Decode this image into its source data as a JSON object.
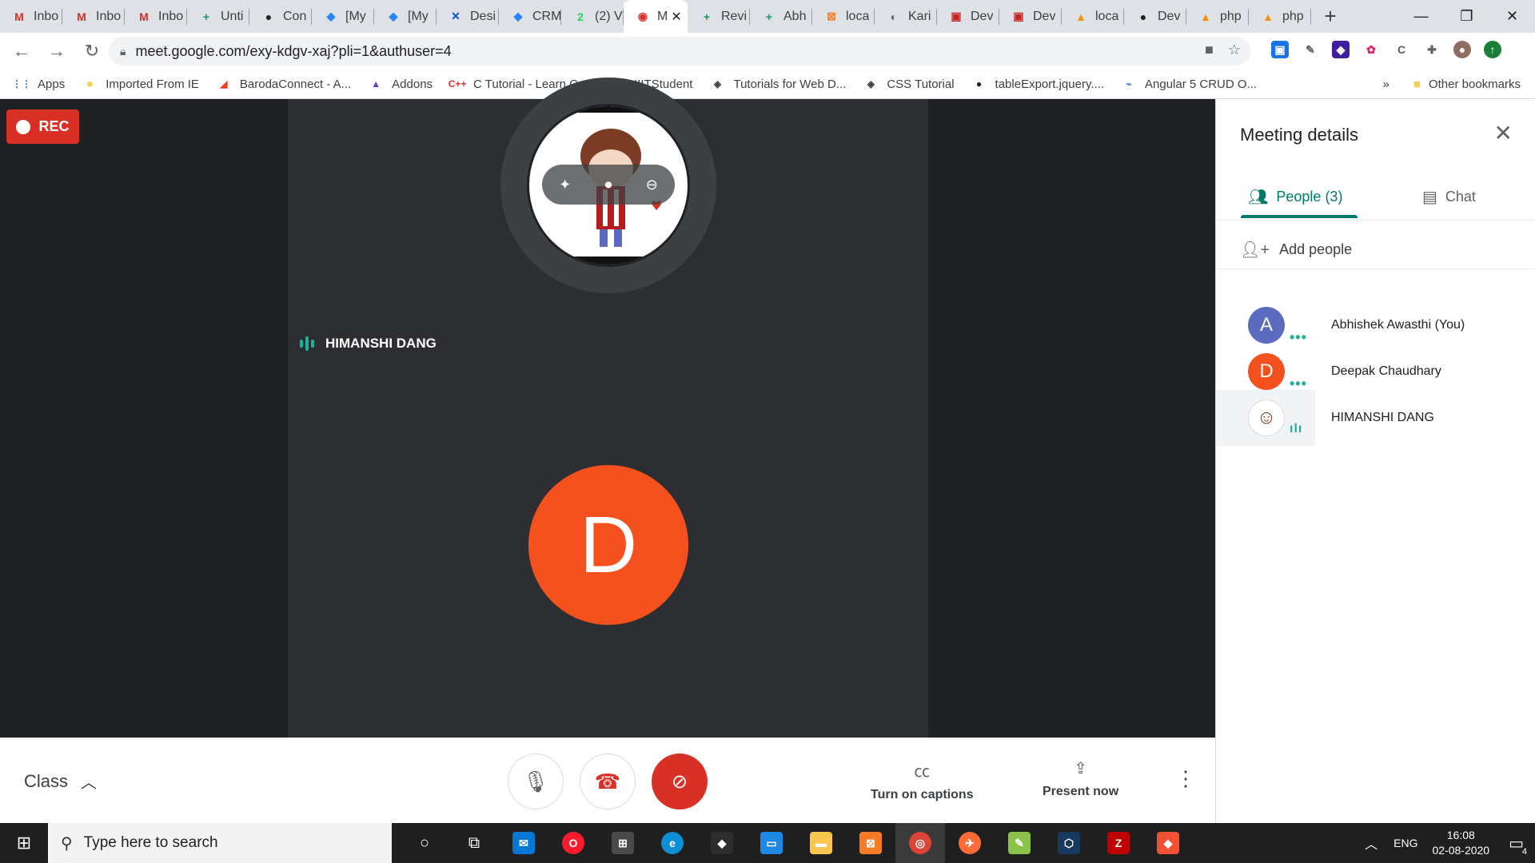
{
  "browser": {
    "tabs": [
      {
        "title": "Inbo",
        "icon": "gmail-icon",
        "color": "#d93025",
        "glyph": "M"
      },
      {
        "title": "Inbo",
        "icon": "gmail-icon",
        "color": "#d93025",
        "glyph": "M"
      },
      {
        "title": "Inbo",
        "icon": "gmail-icon",
        "color": "#d93025",
        "glyph": "M"
      },
      {
        "title": "Unti",
        "icon": "sheets-icon",
        "color": "#0f9d58",
        "glyph": "+"
      },
      {
        "title": "Con",
        "icon": "github-icon",
        "color": "#202124",
        "glyph": "●"
      },
      {
        "title": "[My",
        "icon": "jira-icon",
        "color": "#2684ff",
        "glyph": "◆"
      },
      {
        "title": "[My",
        "icon": "jira-icon",
        "color": "#2684ff",
        "glyph": "◆"
      },
      {
        "title": "Desi",
        "icon": "confluence-icon",
        "color": "#0052cc",
        "glyph": "✕"
      },
      {
        "title": "CRM",
        "icon": "jira-icon",
        "color": "#2684ff",
        "glyph": "◆"
      },
      {
        "title": "(2) V",
        "icon": "whatsapp-icon",
        "color": "#25d366",
        "glyph": "2"
      },
      {
        "title": "M",
        "icon": "recording-icon",
        "color": "#d93025",
        "glyph": "◉",
        "active": true
      },
      {
        "title": "Revi",
        "icon": "sheets-icon",
        "color": "#0f9d58",
        "glyph": "+"
      },
      {
        "title": "Abh",
        "icon": "sheets-icon",
        "color": "#0f9d58",
        "glyph": "+"
      },
      {
        "title": "loca",
        "icon": "xampp-icon",
        "color": "#fb7a24",
        "glyph": "⊠"
      },
      {
        "title": "Kari",
        "icon": "globe-icon",
        "color": "#5f6368",
        "glyph": "◐"
      },
      {
        "title": "Dev",
        "icon": "devtool-icon",
        "color": "#c5221f",
        "glyph": "▣"
      },
      {
        "title": "Dev",
        "icon": "devtool-icon",
        "color": "#c5221f",
        "glyph": "▣"
      },
      {
        "title": "loca",
        "icon": "phpmyadmin-icon",
        "color": "#f29111",
        "glyph": "▲"
      },
      {
        "title": "Dev",
        "icon": "github-icon",
        "color": "#202124",
        "glyph": "●"
      },
      {
        "title": "php",
        "icon": "phpmyadmin-icon",
        "color": "#f29111",
        "glyph": "▲"
      },
      {
        "title": "php",
        "icon": "phpmyadmin-icon",
        "color": "#f29111",
        "glyph": "▲"
      }
    ],
    "url": "meet.google.com/exy-kdgv-xaj?pli=1&authuser=4",
    "bookmarks": [
      {
        "label": "Apps",
        "icon": "apps-grid-icon",
        "color": "#1a73e8",
        "glyph": "⋮⋮"
      },
      {
        "label": "Imported From IE",
        "icon": "folder-icon",
        "color": "#f9ce4b",
        "glyph": "■"
      },
      {
        "label": "BarodaConnect - A...",
        "icon": "baroda-icon",
        "color": "#e8401c",
        "glyph": "◢"
      },
      {
        "label": "Addons",
        "icon": "addons-icon",
        "color": "#673ab7",
        "glyph": "▲"
      },
      {
        "label": "C Tutorial - Learn C...",
        "icon": "cpp-icon",
        "color": "#d93025",
        "glyph": "C++"
      },
      {
        "label": "NIITStudent",
        "icon": "globe-icon",
        "color": "#3c4043",
        "glyph": "◐"
      },
      {
        "label": "Tutorials for Web D...",
        "icon": "diamond-icon",
        "color": "#3c4043",
        "glyph": "◈"
      },
      {
        "label": "CSS Tutorial",
        "icon": "diamond-icon",
        "color": "#3c4043",
        "glyph": "◈"
      },
      {
        "label": "tableExport.jquery....",
        "icon": "github-icon",
        "color": "#202124",
        "glyph": "●"
      },
      {
        "label": "Angular 5 CRUD O...",
        "icon": "angular-icon",
        "color": "#4285f4",
        "glyph": "⌁"
      }
    ],
    "bookmarks_overflow": "»",
    "other_bookmarks": "Other bookmarks"
  },
  "meet": {
    "rec_label": "REC",
    "speaker_name": "HIMANSHI DANG",
    "self_initial": "D",
    "meeting_name": "Class",
    "captions_label": "Turn on captions",
    "present_label": "Present now"
  },
  "panel": {
    "title": "Meeting details",
    "people_tab": "People (3)",
    "chat_tab": "Chat",
    "add_people": "Add people",
    "participants": [
      {
        "initial": "A",
        "name": "Abhishek Awasthi (You)",
        "color": "#5c6bc0"
      },
      {
        "initial": "D",
        "name": "Deepak Chaudhary",
        "color": "#f4511e"
      },
      {
        "initial": "",
        "name": "HIMANSHI DANG",
        "color": "#ffffff"
      }
    ]
  },
  "taskbar": {
    "search_placeholder": "Type here to search",
    "language": "ENG",
    "time": "16:08",
    "date": "02-08-2020",
    "notifications": "4"
  }
}
